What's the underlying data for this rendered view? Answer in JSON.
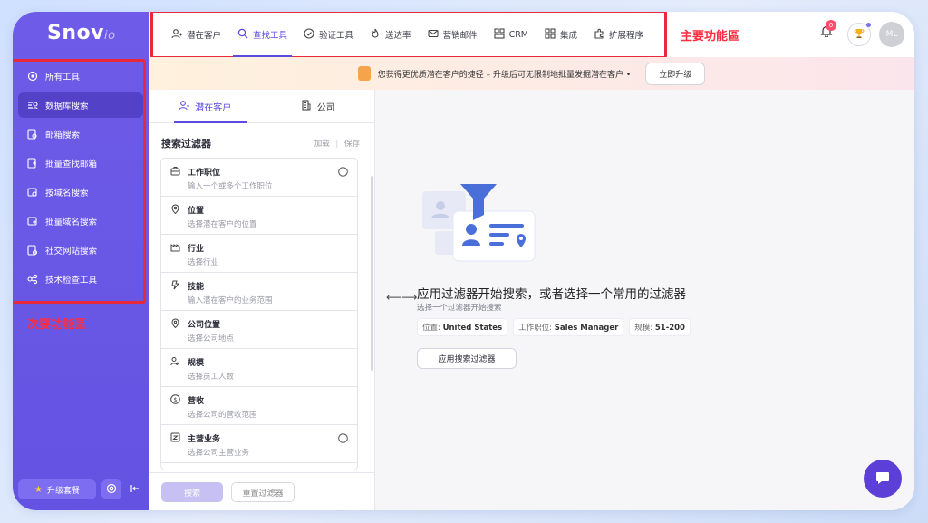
{
  "sidebar": {
    "logo": "Snov",
    "logo_suffix": "io",
    "items": [
      {
        "label": "所有工具",
        "icon": "tools-icon"
      },
      {
        "label": "数据库搜索",
        "icon": "database-search-icon"
      },
      {
        "label": "邮箱搜索",
        "icon": "email-search-icon"
      },
      {
        "label": "批量查找邮箱",
        "icon": "bulk-email-icon"
      },
      {
        "label": "按域名搜索",
        "icon": "domain-search-icon"
      },
      {
        "label": "批量域名搜索",
        "icon": "bulk-domain-icon"
      },
      {
        "label": "社交网站搜索",
        "icon": "social-search-icon"
      },
      {
        "label": "技术检查工具",
        "icon": "tech-checker-icon"
      }
    ],
    "secondary_annotation": "次要功能區",
    "upgrade_label": "升级套餐"
  },
  "topnav": {
    "items": [
      {
        "label": "潜在客户",
        "icon": "prospects-icon"
      },
      {
        "label": "查找工具",
        "icon": "search-icon"
      },
      {
        "label": "验证工具",
        "icon": "verify-icon"
      },
      {
        "label": "送达率",
        "icon": "flame-icon"
      },
      {
        "label": "营销邮件",
        "icon": "mail-icon"
      },
      {
        "label": "CRM",
        "icon": "crm-icon"
      },
      {
        "label": "集成",
        "icon": "integrations-icon"
      },
      {
        "label": "扩展程序",
        "icon": "extensions-icon"
      }
    ],
    "main_annotation": "主要功能區",
    "notification_count": "0",
    "avatar_initials": "ML"
  },
  "banner": {
    "text": "您获得更优质潜在客户的捷径 – 升级后可无限制地批量发掘潜在客户 •",
    "button": "立即升级"
  },
  "panel": {
    "tabs": [
      {
        "label": "潜在客户",
        "icon": "prospect-icon"
      },
      {
        "label": "公司",
        "icon": "company-icon"
      }
    ],
    "filter_title": "搜索过滤器",
    "load_label": "加载",
    "save_label": "保存",
    "filters": [
      {
        "title": "工作职位",
        "placeholder": "输入一个或多个工作职位",
        "icon": "briefcase-icon",
        "info": true
      },
      {
        "title": "位置",
        "placeholder": "选择潜在客户的位置",
        "icon": "location-icon",
        "info": false
      },
      {
        "title": "行业",
        "placeholder": "选择行业",
        "icon": "industry-icon",
        "info": false
      },
      {
        "title": "技能",
        "placeholder": "输入潜在客户的业务范围",
        "icon": "skill-icon",
        "info": false
      },
      {
        "title": "公司位置",
        "placeholder": "选择公司地点",
        "icon": "company-location-icon",
        "info": false
      },
      {
        "title": "规模",
        "placeholder": "选择员工人数",
        "icon": "people-icon",
        "info": false
      },
      {
        "title": "营收",
        "placeholder": "选择公司的营收范围",
        "icon": "revenue-icon",
        "info": false
      },
      {
        "title": "主营业务",
        "placeholder": "选择公司主营业务",
        "icon": "business-icon",
        "info": true
      }
    ],
    "search_button": "搜索",
    "reset_button": "重置过滤器"
  },
  "content": {
    "title": "应用过滤器开始搜索，或者选择一个常用的过滤器",
    "subtitle": "选择一个过滤器开始搜索",
    "chips": [
      {
        "key": "位置: ",
        "value": "United States"
      },
      {
        "key": "工作职位: ",
        "value": "Sales Manager"
      },
      {
        "key": "规模: ",
        "value": "51-200"
      }
    ],
    "apply_button": "应用搜索过滤器"
  },
  "colors": {
    "brand": "#6453e3",
    "accent": "#5b4be0",
    "annotation_red": "#e8293b"
  }
}
